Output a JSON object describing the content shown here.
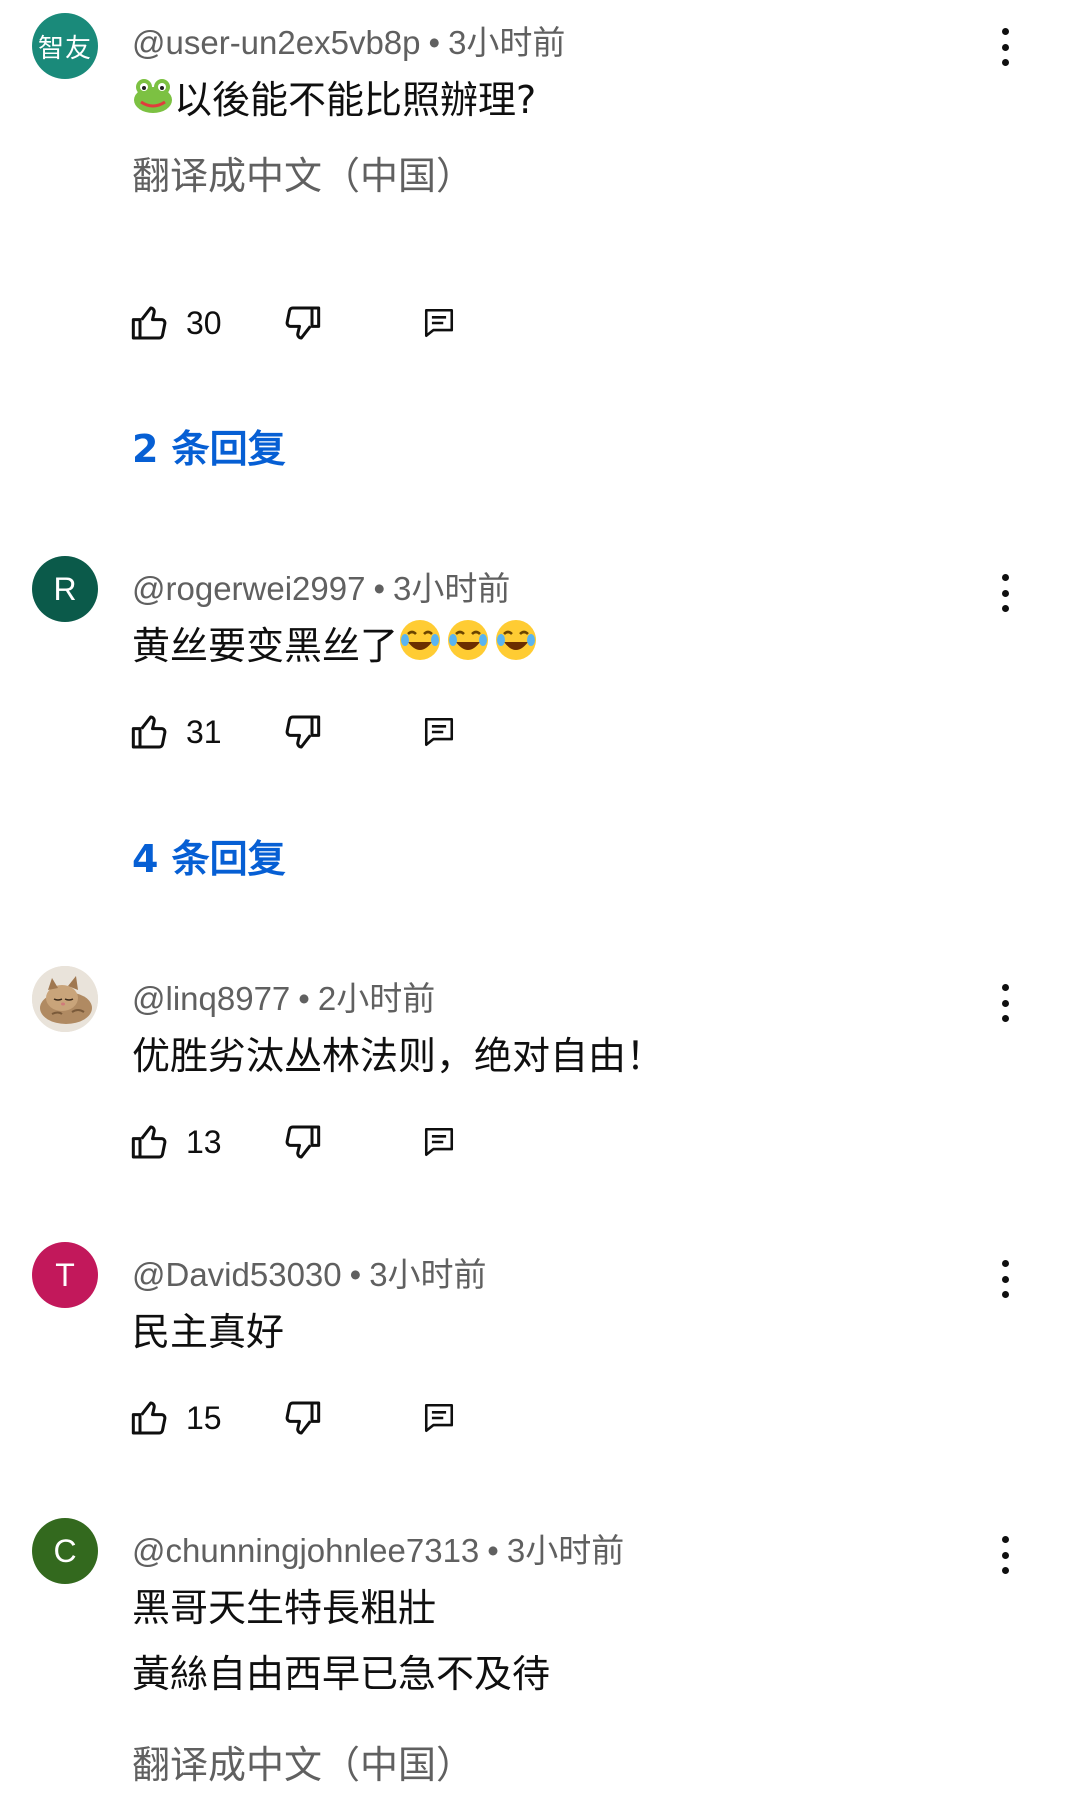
{
  "comments": [
    {
      "avatar_text": "智友",
      "avatar_color": "#1a8a7a",
      "handle": "@user-un2ex5vb8p",
      "time": "3小时前",
      "text_lines": [
        "以後能不能比照辦理?"
      ],
      "leading_emoji": "frog-emoji",
      "translate_label": "翻译成中文（中国）",
      "likes": "30",
      "replies_label": "2 条回复"
    },
    {
      "avatar_text": "R",
      "avatar_color": "#0b5a4a",
      "handle": "@rogerwei2997",
      "time": "3小时前",
      "text_lines": [
        "黄丝要变黑丝了"
      ],
      "trailing_emoji": "tears-of-joy-emoji",
      "likes": "31",
      "replies_label": "4 条回复"
    },
    {
      "avatar_text": "",
      "avatar_color": "#c9b8a2",
      "avatar_image": "sleeping-kitten",
      "handle": "@linq8977",
      "time": "2小时前",
      "text_lines": [
        "优胜劣汰丛林法则，绝对自由！"
      ],
      "likes": "13"
    },
    {
      "avatar_text": "T",
      "avatar_color": "#c2185b",
      "handle": "@David53030",
      "time": "3小时前",
      "text_lines": [
        "民主真好"
      ],
      "likes": "15"
    },
    {
      "avatar_text": "C",
      "avatar_color": "#33691e",
      "handle": "@chunningjohnlee7313",
      "time": "3小时前",
      "text_lines": [
        "黑哥天生特長粗壯",
        "黃絲自由西早已急不及待"
      ],
      "translate_label": "翻译成中文（中国）"
    }
  ],
  "icons": {
    "like": "thumb-up-icon",
    "dislike": "thumb-down-icon",
    "reply": "comment-reply-icon",
    "more": "more-vertical-icon"
  },
  "colors": {
    "link": "#065fd4",
    "secondary_text": "#606060"
  }
}
